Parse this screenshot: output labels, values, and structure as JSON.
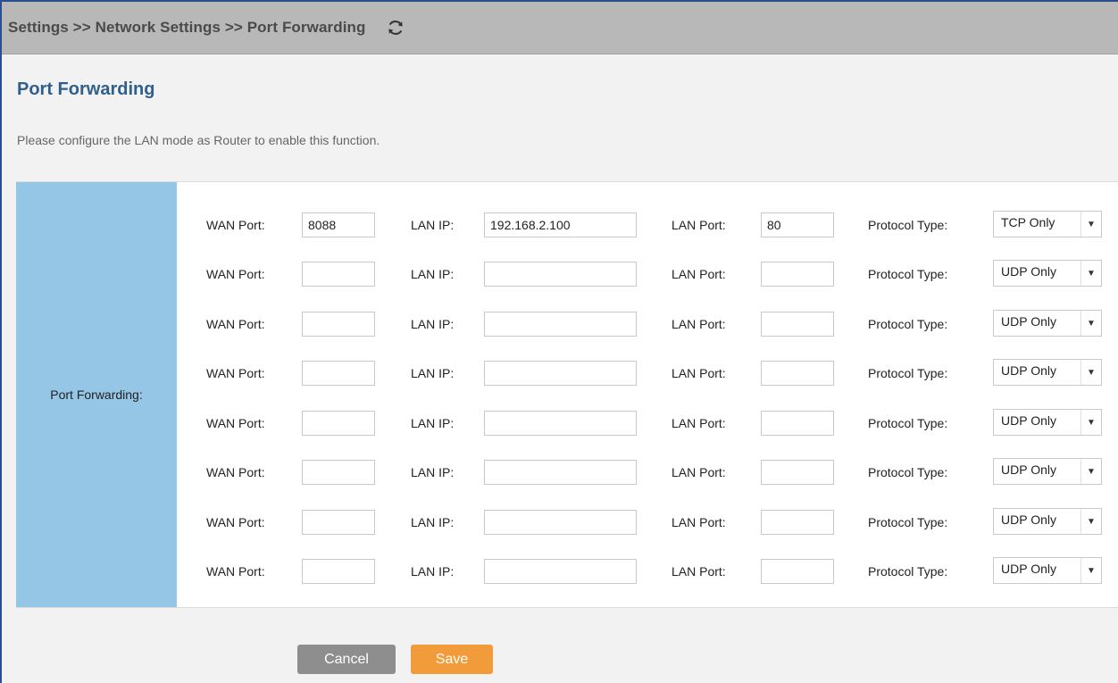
{
  "header": {
    "breadcrumb": "Settings >> Network Settings >> Port Forwarding",
    "refresh_icon": "refresh-icon"
  },
  "page": {
    "title": "Port Forwarding",
    "notice": "Please configure the LAN mode as Router to enable this function."
  },
  "panel": {
    "section_label": "Port Forwarding:",
    "field_labels": {
      "wan_port": "WAN Port:",
      "lan_ip": "LAN IP:",
      "lan_port": "LAN Port:",
      "protocol_type": "Protocol Type:"
    },
    "rows": [
      {
        "wan_port": "8088",
        "lan_ip": "192.168.2.100",
        "lan_port": "80",
        "protocol": "TCP Only"
      },
      {
        "wan_port": "",
        "lan_ip": "",
        "lan_port": "",
        "protocol": "UDP Only"
      },
      {
        "wan_port": "",
        "lan_ip": "",
        "lan_port": "",
        "protocol": "UDP Only"
      },
      {
        "wan_port": "",
        "lan_ip": "",
        "lan_port": "",
        "protocol": "UDP Only"
      },
      {
        "wan_port": "",
        "lan_ip": "",
        "lan_port": "",
        "protocol": "UDP Only"
      },
      {
        "wan_port": "",
        "lan_ip": "",
        "lan_port": "",
        "protocol": "UDP Only"
      },
      {
        "wan_port": "",
        "lan_ip": "",
        "lan_port": "",
        "protocol": "UDP Only"
      },
      {
        "wan_port": "",
        "lan_ip": "",
        "lan_port": "",
        "protocol": "UDP Only"
      }
    ],
    "dropdown_arrow": "▼"
  },
  "actions": {
    "cancel_label": "Cancel",
    "save_label": "Save"
  },
  "colors": {
    "header_bg": "#b8b8b8",
    "title": "#2f5f8a",
    "section_bg": "#95c6e6",
    "cancel": "#8e8e8e",
    "save": "#f19b3a"
  }
}
